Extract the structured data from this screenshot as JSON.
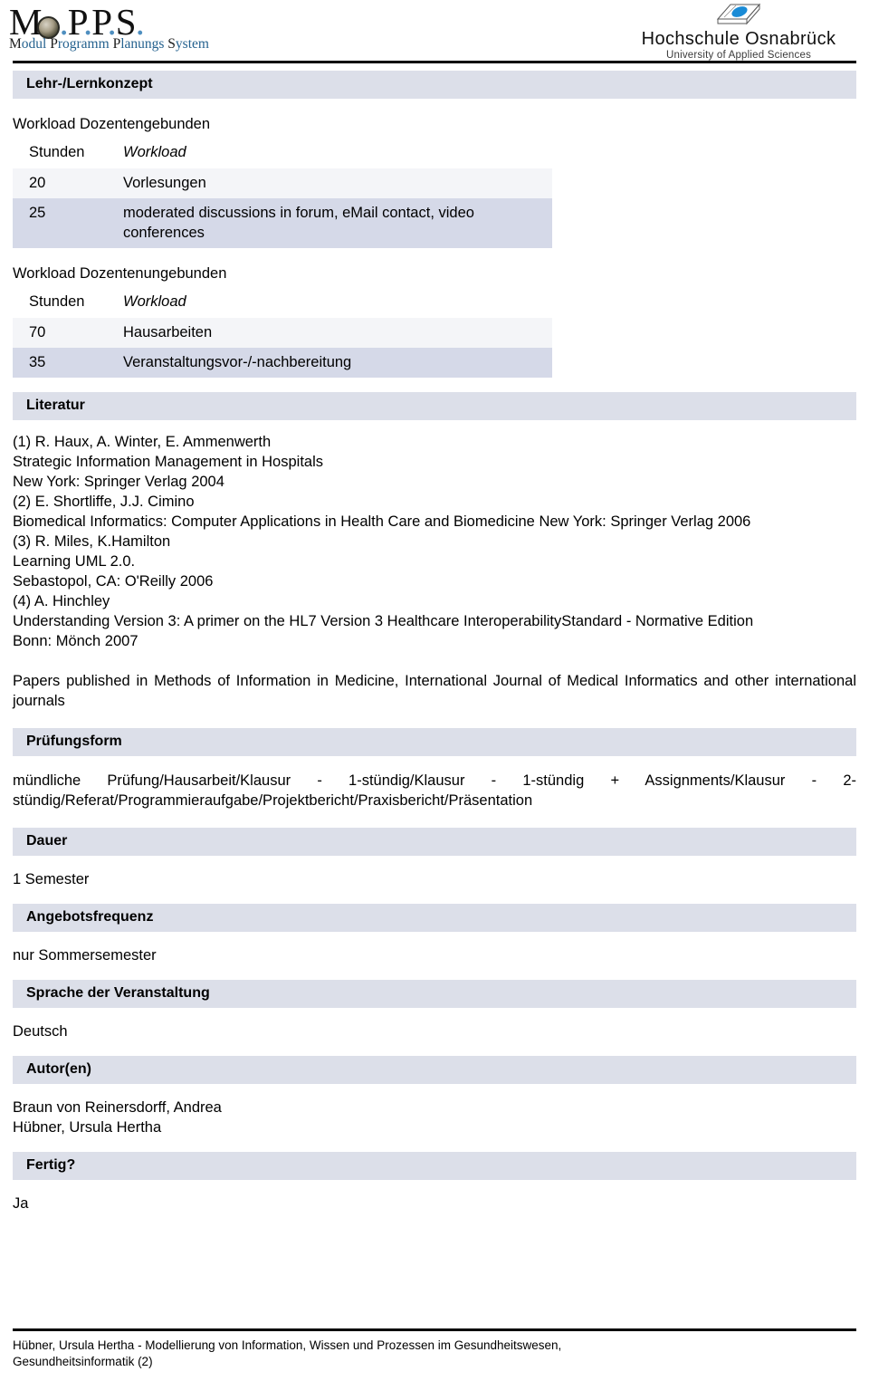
{
  "header": {
    "mopps_logo": {
      "wordmark_parts": [
        "M",
        "o",
        ".",
        "P",
        ".",
        "P",
        ".",
        "S",
        "."
      ],
      "wordmark_text": "Mo.P.P.S.",
      "subtitle_words": [
        "Modul",
        "Programm",
        "Planungs",
        "System"
      ],
      "subtitle_text": "Modul Programm Planungs System"
    },
    "hochschule_logo": {
      "name": "Hochschule Osnabrück",
      "tagline": "University of Applied Sciences"
    }
  },
  "sections": {
    "lehrlernkonzept": {
      "title": "Lehr-/Lernkonzept",
      "workload_dozentengebunden": {
        "heading": "Workload Dozentengebunden",
        "columns": [
          "Stunden",
          "Workload"
        ],
        "rows": [
          {
            "stunden": "20",
            "workload": "Vorlesungen"
          },
          {
            "stunden": "25",
            "workload": "moderated discussions in forum, eMail contact, video conferences"
          }
        ]
      },
      "workload_dozentenungebunden": {
        "heading": "Workload Dozentenungebunden",
        "columns": [
          "Stunden",
          "Workload"
        ],
        "rows": [
          {
            "stunden": "70",
            "workload": "Hausarbeiten"
          },
          {
            "stunden": "35",
            "workload": "Veranstaltungsvor-/-nachbereitung"
          }
        ]
      }
    },
    "literatur": {
      "title": "Literatur",
      "entries": [
        "(1) R. Haux, A. Winter, E. Ammenwerth",
        "Strategic Information Management in Hospitals",
        "New York: Springer Verlag 2004",
        "(2) E. Shortliffe, J.J. Cimino",
        " Biomedical Informatics: Computer Applications in Health Care and Biomedicine New York: Springer Verlag 2006",
        "(3) R. Miles, K.Hamilton",
        "Learning UML 2.0.",
        "Sebastopol, CA: O'Reilly 2006",
        "(4) A. Hinchley",
        "Understanding Version 3: A primer on the HL7 Version 3 Healthcare InteroperabilityStandard - Normative Edition",
        "Bonn: Mönch 2007"
      ],
      "papers_note": "Papers published in Methods of Information in Medicine, International Journal of Medical Informatics and other international journals"
    },
    "pruefungsform": {
      "title": "Prüfungsform",
      "value": "mündliche Prüfung/Hausarbeit/Klausur - 1-stündig/Klausur - 1-stündig + Assignments/Klausur - 2-stündig/Referat/Programmieraufgabe/Projektbericht/Praxisbericht/Präsentation"
    },
    "dauer": {
      "title": "Dauer",
      "value": "1 Semester"
    },
    "angebotsfrequenz": {
      "title": "Angebotsfrequenz",
      "value": "nur Sommersemester"
    },
    "sprache": {
      "title": "Sprache der Veranstaltung",
      "value": "Deutsch"
    },
    "autoren": {
      "title": "Autor(en)",
      "names": [
        "Braun von Reinersdorff, Andrea",
        "Hübner, Ursula Hertha"
      ]
    },
    "fertig": {
      "title": "Fertig?",
      "value": "Ja"
    }
  },
  "footer": {
    "line1": "Hübner, Ursula Hertha - Modellierung von Information, Wissen und Prozessen im Gesundheitswesen,",
    "line2": "Gesundheitsinformatik (2)"
  },
  "colors": {
    "section_bar": "#dcdfe9",
    "row_light": "#f4f5f8",
    "row_dark": "#d5d9e8",
    "accent_blue": "#4f8fc0",
    "subtitle_blue": "#25628f",
    "rule": "#000000"
  }
}
